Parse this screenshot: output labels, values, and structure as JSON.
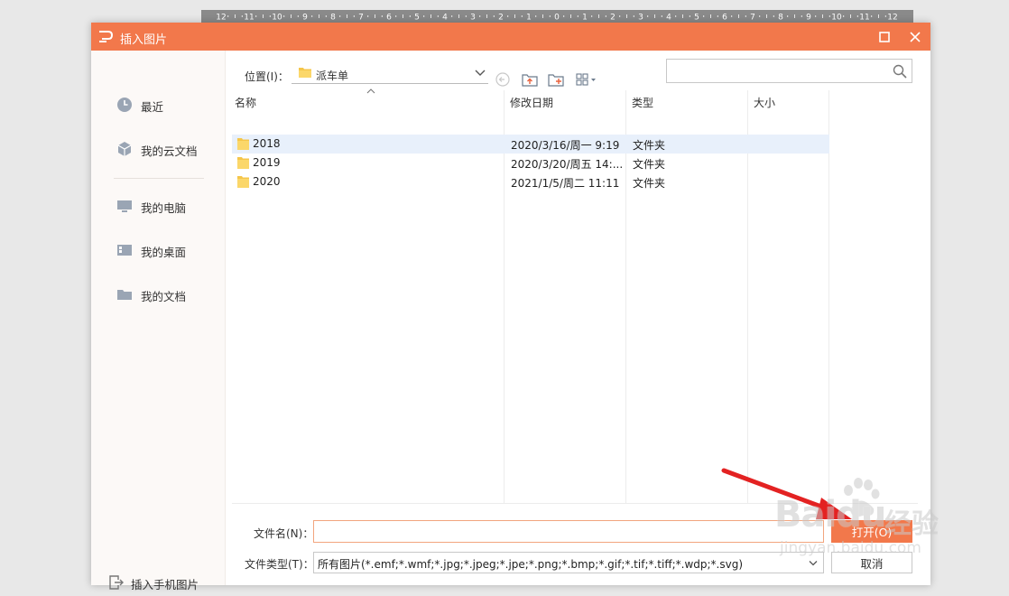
{
  "ruler": {
    "labels": [
      "12",
      "11",
      "10",
      "9",
      "8",
      "7",
      "6",
      "5",
      "4",
      "3",
      "2",
      "1",
      "0",
      "1",
      "2",
      "3",
      "4",
      "5",
      "6",
      "7",
      "8",
      "9",
      "10",
      "11",
      "12"
    ]
  },
  "dialog": {
    "title": "插入图片",
    "accent_color": "#f2784b"
  },
  "sidebar": {
    "items": [
      {
        "label": "最近",
        "icon": "clock-icon"
      },
      {
        "label": "我的云文档",
        "icon": "cloud-box-icon"
      },
      {
        "label": "我的电脑",
        "icon": "monitor-icon"
      },
      {
        "label": "我的桌面",
        "icon": "desktop-icon"
      },
      {
        "label": "我的文档",
        "icon": "folder-icon"
      }
    ],
    "phone_label": "插入手机图片"
  },
  "toolbar": {
    "location_label": "位置(I)：",
    "location_value": "派车单",
    "search_placeholder": ""
  },
  "filelist": {
    "columns": [
      "名称",
      "修改日期",
      "类型",
      "大小"
    ],
    "rows": [
      {
        "name": "2018",
        "date": "2020/3/16/周一 9:19",
        "type": "文件夹",
        "size": "",
        "selected": true
      },
      {
        "name": "2019",
        "date": "2020/3/20/周五 14:...",
        "type": "文件夹",
        "size": "",
        "selected": false
      },
      {
        "name": "2020",
        "date": "2021/1/5/周二 11:11",
        "type": "文件夹",
        "size": "",
        "selected": false
      }
    ]
  },
  "form": {
    "filename_label": "文件名(N)：",
    "filename_value": "",
    "filetype_label": "文件类型(T)：",
    "filetype_value": "所有图片(*.emf;*.wmf;*.jpg;*.jpeg;*.jpe;*.png;*.bmp;*.gif;*.tif;*.tiff;*.wdp;*.svg)",
    "open_label": "打开(O)",
    "cancel_label": "取消"
  },
  "watermark": {
    "brand": "Bai",
    "brand_du": "du",
    "cn": "经验",
    "url": "jingyan.baidu.com"
  }
}
